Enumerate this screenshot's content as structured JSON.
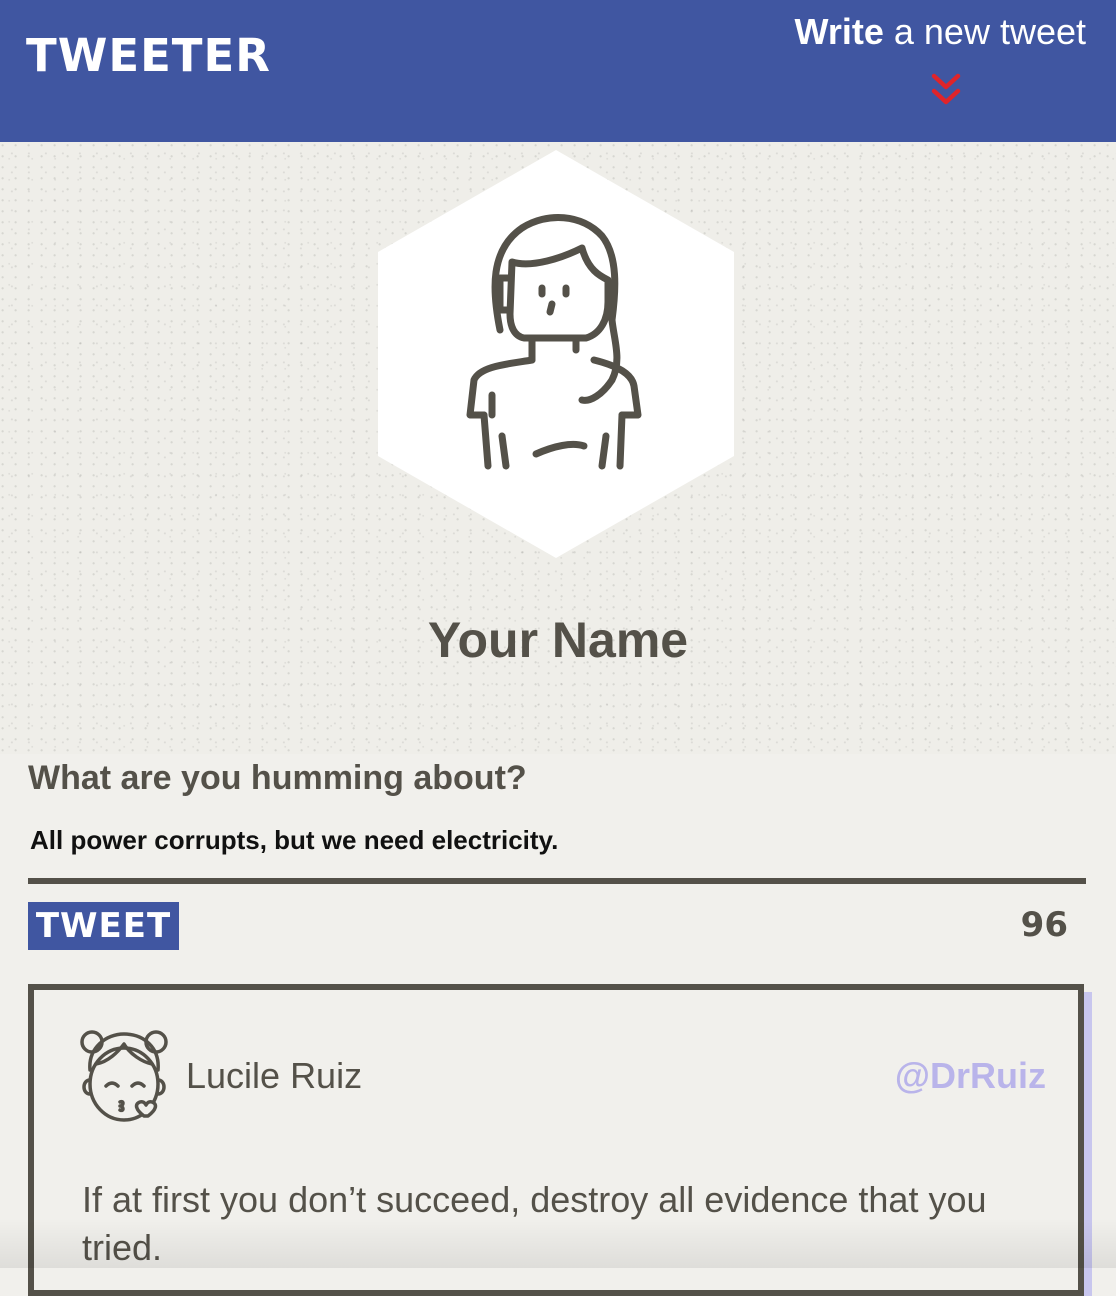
{
  "nav": {
    "brand": "TWEETER",
    "write_bold": "Write",
    "write_rest": " a new tweet",
    "chevron_icon": "double-chevron-down-icon",
    "chevron_color": "#e0242a",
    "background_color": "#4056a1"
  },
  "profile": {
    "avatar_icon": "woman-avatar-icon",
    "name": "Your Name"
  },
  "compose": {
    "label": "What are you humming about?",
    "value": "All power corrupts, but we need electricity.",
    "tweet_button": "TWEET",
    "counter": "96"
  },
  "tweets": [
    {
      "avatar_icon": "kissing-girl-avatar-icon",
      "author": "Lucile Ruiz",
      "handle": "@DrRuiz",
      "content": "If at first you don’t succeed, destroy all evidence that you tried."
    }
  ],
  "colors": {
    "accent": "#4056a1",
    "text": "#545149",
    "page_background": "#f1f0ec",
    "handle": "#b9b4ea"
  }
}
